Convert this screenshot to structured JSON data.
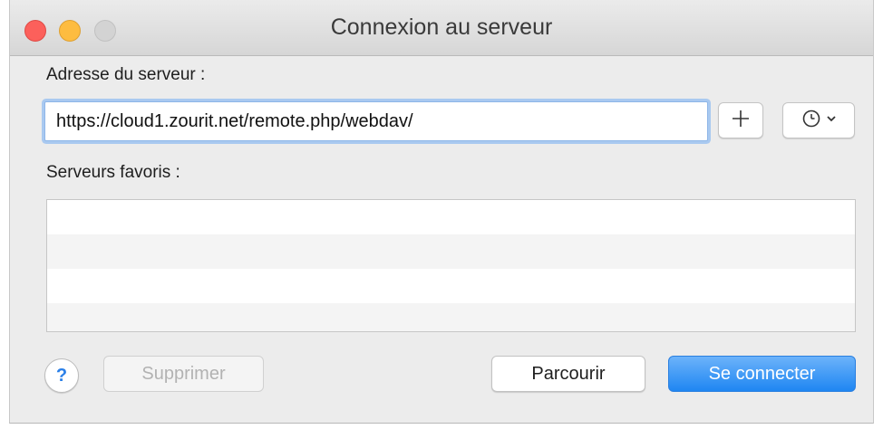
{
  "window": {
    "title": "Connexion au serveur"
  },
  "address": {
    "label": "Adresse du serveur :",
    "value": "https://cloud1.zourit.net/remote.php/webdav/",
    "add_icon": "plus-icon",
    "recent_icon": "clock-icon"
  },
  "favorites": {
    "label": "Serveurs favoris :",
    "items": []
  },
  "buttons": {
    "help": "?",
    "delete": "Supprimer",
    "browse": "Parcourir",
    "connect": "Se connecter"
  },
  "colors": {
    "accent": "#1f86f2",
    "close": "#fc605b",
    "minimize": "#fdbc40",
    "zoom_disabled": "#d3d3d3"
  }
}
